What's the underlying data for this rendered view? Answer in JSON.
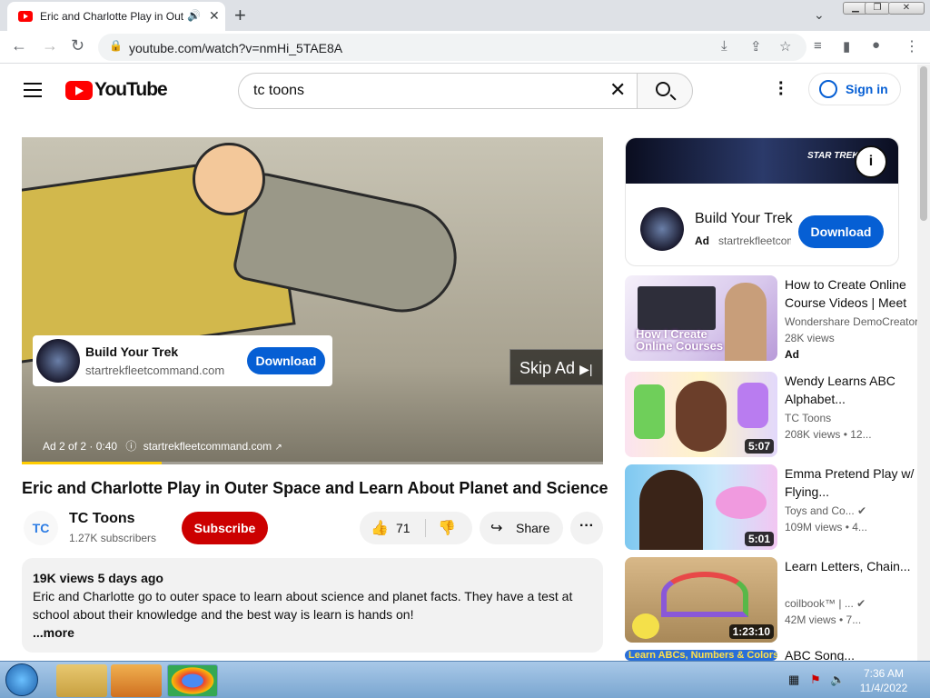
{
  "browser": {
    "tab_title": "Eric and Charlotte Play in Outer Space and Learn About Planet and Science",
    "url": "youtube.com/watch?v=nmHi_5TAE8A"
  },
  "youtube": {
    "logo_text": "YouTube",
    "search_query": "tc toons",
    "sign_in_label": "Sign in"
  },
  "player": {
    "overlay_ad_title": "Build Your Trek",
    "overlay_ad_domain": "startrekfleetcommand.com",
    "overlay_ad_button": "Download",
    "skip_label": "Skip Ad",
    "ad_counter": "Ad 2 of 2 · 0:40",
    "ad_link": "startrekfleetcommand.com",
    "ad_progress_fraction": 0.24
  },
  "video": {
    "title": "Eric and Charlotte Play in Outer Space and Learn About Planet and Science",
    "channel_name": "TC Toons",
    "channel_avatar_text": "TC",
    "subscribers": "1.27K subscribers",
    "subscribe_label": "Subscribe",
    "likes": "71",
    "share_label": "Share",
    "views_date": "19K views  5 days ago",
    "description_line1": "Eric and Charlotte go to outer space to learn about science and planet facts. They have a test at",
    "description_line2": "school about their knowledge and the best way is learn is hands on!",
    "more_label": "...more"
  },
  "sidebar_ad": {
    "brand_text": "STAR TREK",
    "title": "Build Your Trek",
    "ad_label": "Ad",
    "domain": "startrekfleetcommand.com",
    "button": "Download"
  },
  "recommendations": [
    {
      "title": "How to Create Online Course Videos | Meet the Creators",
      "channel": "Wondershare DemoCreator",
      "views": "28K views",
      "ad_label": "Ad",
      "thumb_text1": "How I Create",
      "thumb_text2": "Online Courses",
      "duration": ""
    },
    {
      "title": "Wendy Learns ABC Alphabet...",
      "channel": "TC Toons",
      "views": "208K views  • 12...",
      "duration": "5:07"
    },
    {
      "title": "Emma Pretend Play w/ Flying...",
      "channel": "Toys and Co... ✔",
      "views": "109M views  • 4...",
      "duration": "5:01"
    },
    {
      "title": "Learn Letters, Chain...",
      "channel": "coilbook™ | ... ✔",
      "views": "42M views  • 7...",
      "duration": "1:23:10"
    },
    {
      "title": "ABC Song...",
      "thumb_text1": "Learn ABCs, Numbers & Colors"
    }
  ],
  "taskbar": {
    "time": "7:36 AM",
    "date": "11/4/2022"
  }
}
